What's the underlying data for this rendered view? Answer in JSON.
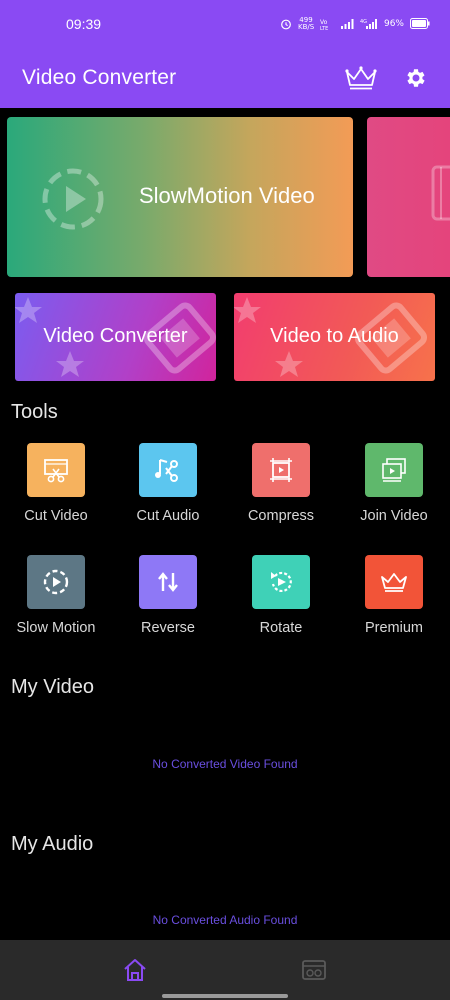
{
  "status": {
    "time": "09:39",
    "speed": "499 KB/S",
    "battery": "96%"
  },
  "app": {
    "title": "Video Converter"
  },
  "banner": {
    "title": "SlowMotion Video"
  },
  "cards": [
    {
      "label": "Video Converter"
    },
    {
      "label": "Video to Audio"
    }
  ],
  "tools": {
    "title": "Tools",
    "items": [
      {
        "label": "Cut Video",
        "icon": "cut-video-icon",
        "color": "#f6b25e"
      },
      {
        "label": "Cut Audio",
        "icon": "cut-audio-icon",
        "color": "#5cc6ef"
      },
      {
        "label": "Compress",
        "icon": "compress-icon",
        "color": "#ef6f6c"
      },
      {
        "label": "Join Video",
        "icon": "join-video-icon",
        "color": "#5fb86c"
      },
      {
        "label": "Slow Motion",
        "icon": "slow-motion-icon",
        "color": "#5d7785"
      },
      {
        "label": "Reverse",
        "icon": "reverse-icon",
        "color": "#8e78f6"
      },
      {
        "label": "Rotate",
        "icon": "rotate-icon",
        "color": "#3fd1b7"
      },
      {
        "label": "Premium",
        "icon": "crown-icon",
        "color": "#f25438"
      }
    ]
  },
  "my_video": {
    "title": "My Video",
    "empty": "No Converted Video Found"
  },
  "my_audio": {
    "title": "My Audio",
    "empty": "No Converted Audio Found"
  },
  "colors": {
    "accent": "#8a4af3",
    "empty_text": "#6a4fe0",
    "nav_bg": "#2a2a2a"
  }
}
